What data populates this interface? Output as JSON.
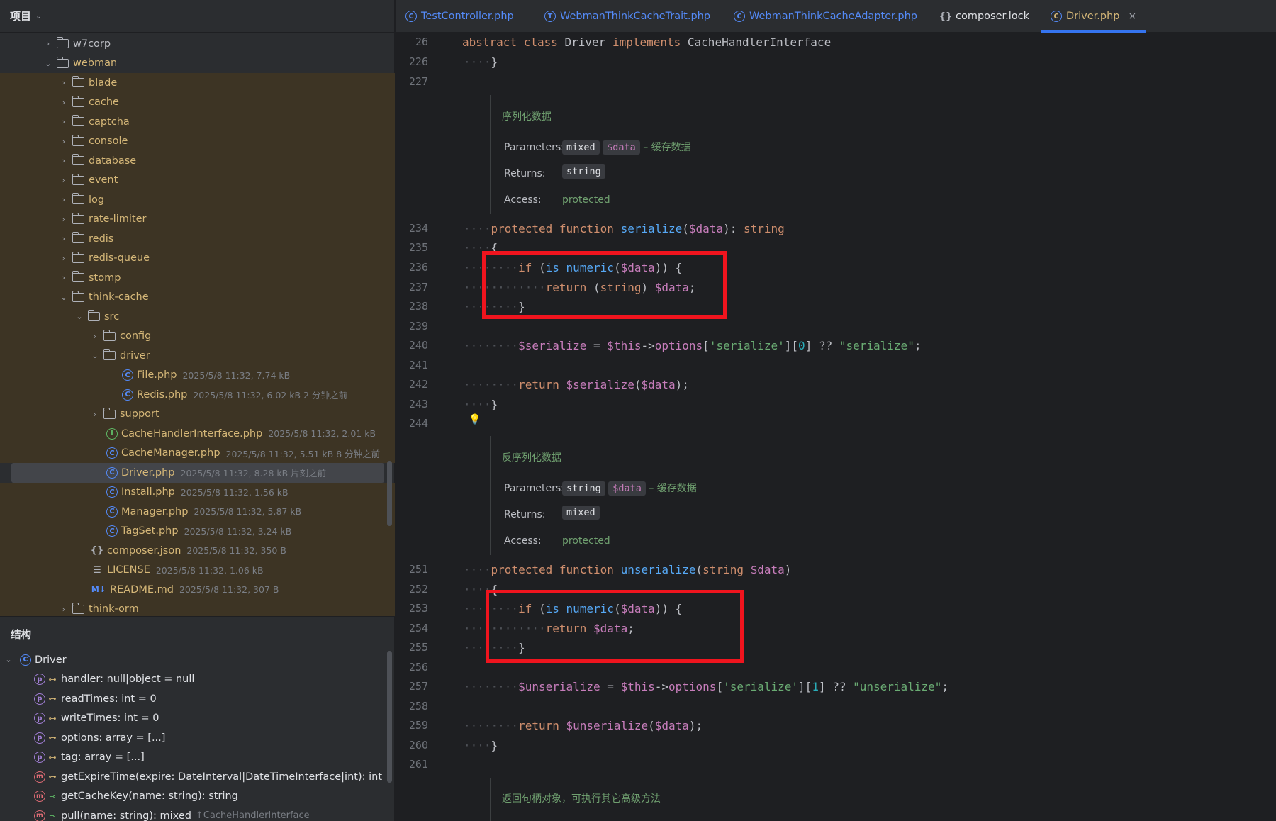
{
  "project": {
    "title": "项目",
    "tree": [
      {
        "depth": 0,
        "type": "folder",
        "open": false,
        "name": "w7corp"
      },
      {
        "depth": 0,
        "type": "folder",
        "open": true,
        "name": "webman"
      },
      {
        "depth": 1,
        "type": "folder",
        "open": false,
        "name": "blade"
      },
      {
        "depth": 1,
        "type": "folder",
        "open": false,
        "name": "cache"
      },
      {
        "depth": 1,
        "type": "folder",
        "open": false,
        "name": "captcha"
      },
      {
        "depth": 1,
        "type": "folder",
        "open": false,
        "name": "console"
      },
      {
        "depth": 1,
        "type": "folder",
        "open": false,
        "name": "database"
      },
      {
        "depth": 1,
        "type": "folder",
        "open": false,
        "name": "event"
      },
      {
        "depth": 1,
        "type": "folder",
        "open": false,
        "name": "log"
      },
      {
        "depth": 1,
        "type": "folder",
        "open": false,
        "name": "rate-limiter"
      },
      {
        "depth": 1,
        "type": "folder",
        "open": false,
        "name": "redis"
      },
      {
        "depth": 1,
        "type": "folder",
        "open": false,
        "name": "redis-queue"
      },
      {
        "depth": 1,
        "type": "folder",
        "open": false,
        "name": "stomp"
      },
      {
        "depth": 1,
        "type": "folder",
        "open": true,
        "name": "think-cache"
      },
      {
        "depth": 2,
        "type": "folder",
        "open": true,
        "name": "src"
      },
      {
        "depth": 3,
        "type": "folder",
        "open": false,
        "name": "config"
      },
      {
        "depth": 3,
        "type": "folder",
        "open": true,
        "name": "driver"
      },
      {
        "depth": 4,
        "type": "class",
        "name": "File.php",
        "meta": "2025/5/8 11:32, 7.74 kB"
      },
      {
        "depth": 4,
        "type": "class",
        "name": "Redis.php",
        "meta": "2025/5/8 11:32, 6.02 kB 2 分钟之前"
      },
      {
        "depth": 3,
        "type": "folder",
        "open": false,
        "name": "support"
      },
      {
        "depth": 3,
        "type": "interface",
        "name": "CacheHandlerInterface.php",
        "meta": "2025/5/8 11:32, 2.01 kB"
      },
      {
        "depth": 3,
        "type": "class",
        "name": "CacheManager.php",
        "meta": "2025/5/8 11:32, 5.51 kB 8 分钟之前"
      },
      {
        "depth": 3,
        "type": "class",
        "name": "Driver.php",
        "meta": "2025/5/8 11:32, 8.28 kB 片刻之前",
        "selected": true
      },
      {
        "depth": 3,
        "type": "class",
        "name": "Install.php",
        "meta": "2025/5/8 11:32, 1.56 kB"
      },
      {
        "depth": 3,
        "type": "class",
        "name": "Manager.php",
        "meta": "2025/5/8 11:32, 5.87 kB"
      },
      {
        "depth": 3,
        "type": "class",
        "name": "TagSet.php",
        "meta": "2025/5/8 11:32, 3.24 kB"
      },
      {
        "depth": 2,
        "type": "json",
        "name": "composer.json",
        "meta": "2025/5/8 11:32, 350 B"
      },
      {
        "depth": 2,
        "type": "license",
        "name": "LICENSE",
        "meta": "2025/5/8 11:32, 1.06 kB"
      },
      {
        "depth": 2,
        "type": "markdown",
        "name": "README.md",
        "meta": "2025/5/8 11:32, 307 B"
      },
      {
        "depth": 1,
        "type": "folder",
        "open": false,
        "name": "think-orm"
      }
    ]
  },
  "structure": {
    "title": "结构",
    "root": "Driver",
    "members": [
      {
        "kind": "p",
        "access": "protected",
        "text": "handler: null|object = null"
      },
      {
        "kind": "p",
        "access": "protected",
        "text": "readTimes: int = 0"
      },
      {
        "kind": "p",
        "access": "protected",
        "text": "writeTimes: int = 0"
      },
      {
        "kind": "p",
        "access": "protected",
        "text": "options: array = [...]"
      },
      {
        "kind": "p",
        "access": "protected",
        "text": "tag: array = [...]"
      },
      {
        "kind": "m",
        "access": "protected",
        "text": "getExpireTime(expire: DateInterval|DateTimeInterface|int): int"
      },
      {
        "kind": "m",
        "access": "public",
        "text": "getCacheKey(name: string): string"
      },
      {
        "kind": "m",
        "access": "public",
        "text": "pull(name: string): mixed",
        "sub": "↑CacheHandlerInterface"
      }
    ]
  },
  "tabs": [
    {
      "label": "TestController.php",
      "icon": "C"
    },
    {
      "label": "WebmanThinkCacheTrait.php",
      "icon": "T"
    },
    {
      "label": "WebmanThinkCacheAdapter.php",
      "icon": "C"
    },
    {
      "label": "composer.lock",
      "icon": "{}"
    },
    {
      "label": "Driver.php",
      "icon": "C",
      "active": true
    }
  ],
  "editor": {
    "sticky": {
      "line": "26",
      "code": "abstract class Driver implements CacheHandlerInterface"
    },
    "doc1": {
      "title": "序列化数据",
      "params_label": "Parameters:",
      "param_type": "mixed",
      "param_var": "$data",
      "param_desc": "– 缓存数据",
      "returns_label": "Returns:",
      "returns": "string",
      "access_label": "Access:",
      "access": "protected"
    },
    "doc2": {
      "title": "反序列化数据",
      "params_label": "Parameters:",
      "param_type": "string",
      "param_var": "$data",
      "param_desc": "– 缓存数据",
      "returns_label": "Returns:",
      "returns": "mixed",
      "access_label": "Access:",
      "access": "protected"
    },
    "doc3": {
      "title": "返回句柄对象，可执行其它高级方法"
    },
    "line_numbers": [
      "226",
      "227",
      "234",
      "235",
      "236",
      "237",
      "238",
      "239",
      "240",
      "241",
      "242",
      "243",
      "244",
      "251",
      "252",
      "253",
      "254",
      "255",
      "256",
      "257",
      "258",
      "259",
      "260",
      "261"
    ]
  }
}
